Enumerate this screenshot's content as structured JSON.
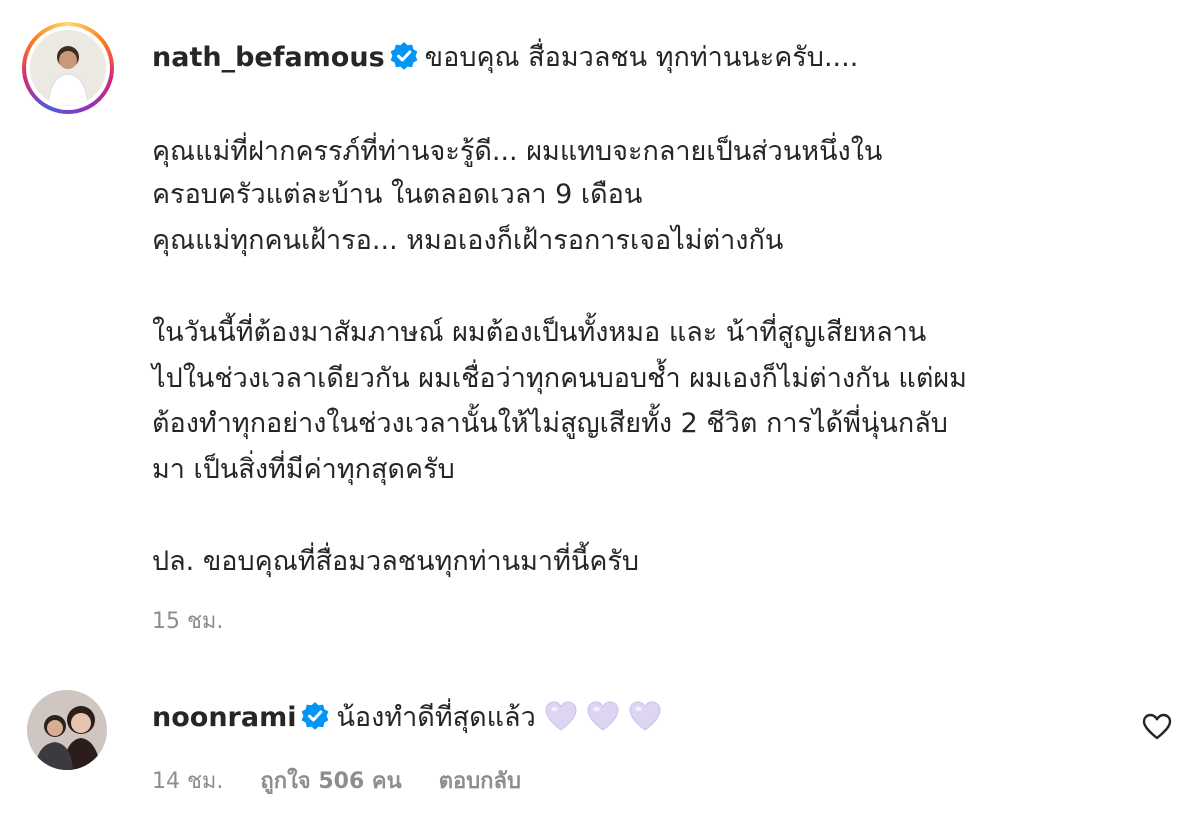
{
  "post": {
    "username": "nath_befamous",
    "verified": true,
    "lines": [
      "ขอบคุณ สื่อมวลชน ทุกท่านนะครับ....",
      "คุณแม่ที่ฝากครรภ์ที่ท่านจะรู้ดี... ผมแทบจะกลายเป็นส่วนหนึ่งใน",
      "ครอบครัวแต่ละบ้าน ในตลอดเวลา 9 เดือน",
      "คุณแม่ทุกคนเฝ้ารอ... หมอเองก็เฝ้ารอการเจอไม่ต่างกัน",
      "ในวันนี้ที่ต้องมาสัมภาษณ์ ผมต้องเป็นทั้งหมอ และ น้าที่สูญเสียหลาน",
      "ไปในช่วงเวลาเดียวกัน ผมเชื่อว่าทุกคนบอบช้ำ ผมเองก็ไม่ต่างกัน แต่ผม",
      "ต้องทำทุกอย่างในช่วงเวลานั้นให้ไม่สูญเสียทั้ง 2 ชีวิต การได้พี่นุ่นกลับ",
      "มา เป็นสิ่งที่มีค่าทุกสุดครับ",
      "ปล. ขอบคุณที่สื่อมวลชนทุกท่านมาที่นี้ครับ"
    ],
    "time": "15 ชม."
  },
  "reply": {
    "username": "noonrami",
    "verified": true,
    "text": "น้องทำดีที่สุดแล้ว",
    "emoji": [
      "light-purple-heart-icon",
      "light-purple-heart-icon",
      "light-purple-heart-icon"
    ],
    "time": "14 ชม.",
    "likes": "ถูกใจ 506 คน",
    "reply_label": "ตอบกลับ"
  },
  "colors": {
    "text": "#262626",
    "muted": "#8e8e8e",
    "verified": "#0095f6",
    "heart": "#d9d2f2"
  }
}
